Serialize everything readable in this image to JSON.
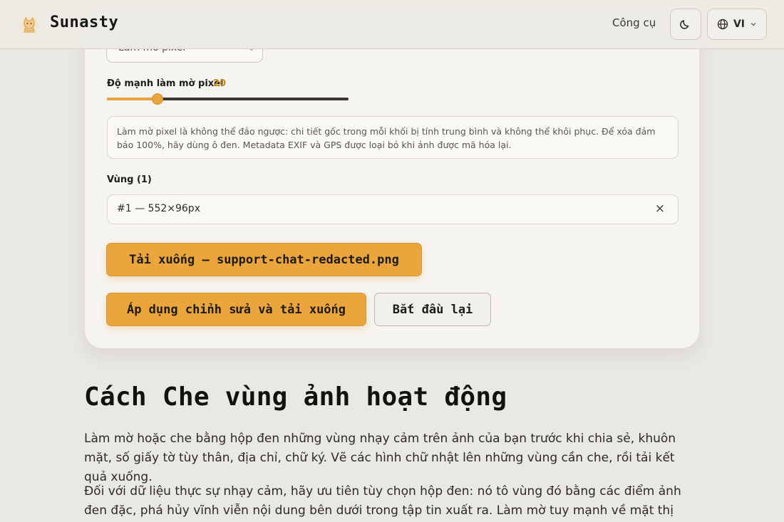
{
  "header": {
    "brand": "Sunasty",
    "nav_tools": "Công cụ",
    "theme_icon": "moon-icon",
    "lang_icon": "globe-icon",
    "lang": "VI"
  },
  "editor": {
    "mode_select": "Làm mờ pixel",
    "strength_label": "Độ mạnh làm mờ pixel",
    "strength_value": "20",
    "strength_fraction": 0.21,
    "notice": "Làm mờ pixel là không thể đảo ngược: chi tiết gốc trong mỗi khối bị tính trung bình và không thể khôi phục. Để xóa đảm bảo 100%, hãy dùng ô đen. Metadata EXIF và GPS được loại bỏ khi ảnh được mã hóa lại.",
    "regions_label": "Vùng (1)",
    "regions": [
      {
        "label": "#1 — 552×96px",
        "remove": "×"
      }
    ],
    "download_button": "Tải xuống — support-chat-redacted.png",
    "apply_button": "Áp dụng chỉnh sửa và tải xuống",
    "restart_button": "Bắt đầu lại"
  },
  "article": {
    "title": "Cách Che vùng ảnh hoạt động",
    "paragraphs": [
      "Làm mờ hoặc che bằng hộp đen những vùng nhạy cảm trên ảnh của bạn trước khi chia sẻ, khuôn mặt, số giấy tờ tùy thân, địa chỉ, chữ ký. Vẽ các hình chữ nhật lên những vùng cần che, rồi tải kết quả xuống.",
      "Đối với dữ liệu thực sự nhạy cảm, hãy ưu tiên tùy chọn hộp đen: nó tô vùng đó bằng các điểm ảnh đen đặc, phá hủy vĩnh viễn nội dung bên dưới trong tập tin xuất ra. Làm mờ tuy mạnh về mặt thị giác nhưng không được"
    ]
  }
}
